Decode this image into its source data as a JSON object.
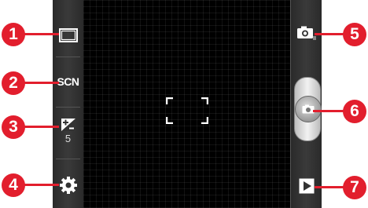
{
  "callouts": {
    "c1": "1",
    "c2": "2",
    "c3": "3",
    "c4": "4",
    "c5": "5",
    "c6": "6",
    "c7": "7"
  },
  "left_panel": {
    "shooting_mode_icon": "rectangle-frame-icon",
    "scene_label": "SCN",
    "exposure_icon": "exposure-plus-minus-icon",
    "exposure_value": "5",
    "settings_icon": "gear-icon"
  },
  "right_panel": {
    "camera_switch_icon": "camera-icon",
    "shutter_icon": "camera-shutter-icon",
    "gallery_icon": "play-triangle-icon"
  },
  "colors": {
    "callout": "#e21e2d",
    "panel": "#333333",
    "viewfinder": "#000000"
  }
}
